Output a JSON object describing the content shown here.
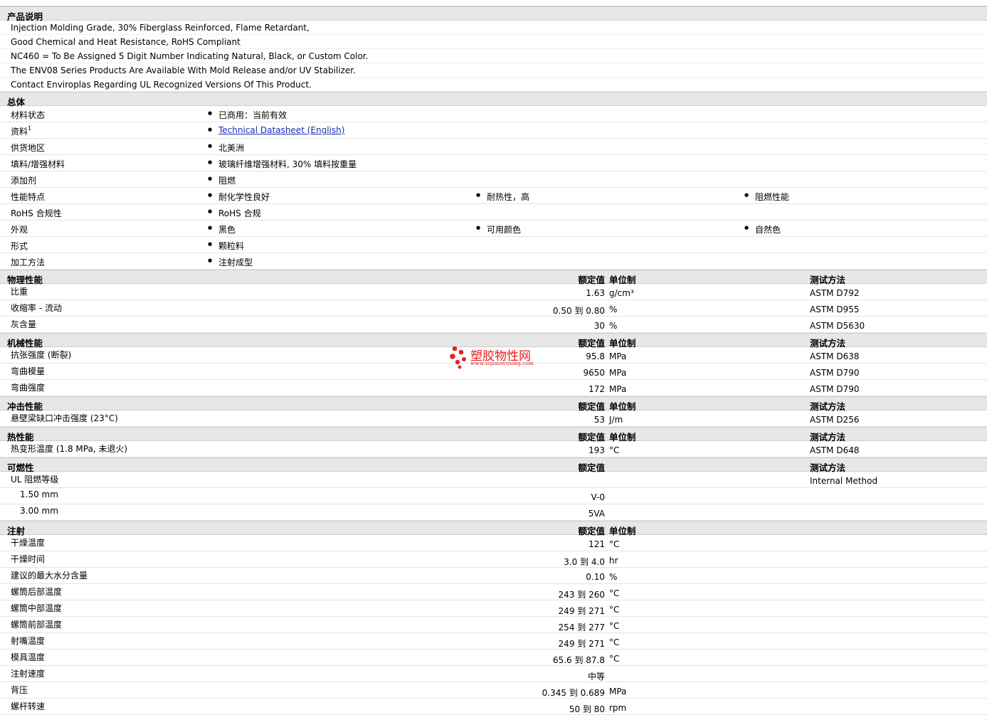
{
  "desc": {
    "title": "产品说明",
    "lines": [
      "Injection Molding Grade, 30% Fiberglass Reinforced, Flame Retardant,",
      "Good Chemical and Heat Resistance, RoHS Compliant",
      "NC460 = To Be Assigned 5 Digit Number Indicating Natural, Black, or Custom Color.",
      "The ENV08 Series Products Are Available With Mold Release and/or UV Stabilizer.",
      "Contact Enviroplas Regarding UL Recognized Versions Of This Product."
    ]
  },
  "general": {
    "title": "总体",
    "rows": [
      {
        "label": "材料状态",
        "items": [
          "已商用：当前有效"
        ]
      },
      {
        "label": "资料",
        "sup": "1",
        "items": [
          "Technical Datasheet (English)"
        ],
        "link": true
      },
      {
        "label": "供货地区",
        "items": [
          "北美洲"
        ]
      },
      {
        "label": "填料/增强材料",
        "items": [
          "玻璃纤维增强材料, 30% 填料按重量"
        ]
      },
      {
        "label": "添加剂",
        "items": [
          "阻燃"
        ]
      },
      {
        "label": "性能特点",
        "items": [
          "耐化学性良好",
          "耐热性，高",
          "阻燃性能"
        ]
      },
      {
        "label": "RoHS 合规性",
        "items": [
          "RoHS 合规"
        ]
      },
      {
        "label": "外观",
        "items": [
          "黑色",
          "可用颜色",
          "自然色"
        ]
      },
      {
        "label": "形式",
        "items": [
          "颗粒料"
        ]
      },
      {
        "label": "加工方法",
        "items": [
          "注射成型"
        ]
      }
    ]
  },
  "headers": {
    "value": "额定值",
    "unit": "单位制",
    "method": "测试方法"
  },
  "sections": [
    {
      "title": "物理性能",
      "showUnit": true,
      "showMethod": true,
      "rows": [
        {
          "label": "比重",
          "value": "1.63",
          "unit": "g/cm³",
          "method": "ASTM D792"
        },
        {
          "label": "收缩率 - 流动",
          "value": "0.50 到  0.80",
          "unit": "%",
          "method": "ASTM D955"
        },
        {
          "label": "灰含量",
          "value": "30",
          "unit": "%",
          "method": "ASTM D5630"
        }
      ]
    },
    {
      "title": "机械性能",
      "showUnit": true,
      "showMethod": true,
      "rows": [
        {
          "label": "抗张强度 (断裂)",
          "value": "95.8",
          "unit": "MPa",
          "method": "ASTM D638"
        },
        {
          "label": "弯曲模量",
          "value": "9650",
          "unit": "MPa",
          "method": "ASTM D790"
        },
        {
          "label": "弯曲强度",
          "value": "172",
          "unit": "MPa",
          "method": "ASTM D790"
        }
      ]
    },
    {
      "title": "冲击性能",
      "showUnit": true,
      "showMethod": true,
      "rows": [
        {
          "label": "悬壁梁缺口冲击强度 (23°C)",
          "value": "53",
          "unit": "J/m",
          "method": "ASTM D256"
        }
      ]
    },
    {
      "title": "热性能",
      "showUnit": true,
      "showMethod": true,
      "rows": [
        {
          "label": "热变形温度 (1.8 MPa, 未退火)",
          "value": "193",
          "unit": "°C",
          "method": "ASTM D648"
        }
      ]
    },
    {
      "title": "可燃性",
      "showUnit": false,
      "showMethod": true,
      "rows": [
        {
          "label": "UL 阻燃等级",
          "value": "",
          "unit": "",
          "method": "Internal Method"
        },
        {
          "label": "1.50 mm",
          "value": "V-0",
          "unit": "",
          "method": "",
          "sub": true
        },
        {
          "label": "3.00 mm",
          "value": "5VA",
          "unit": "",
          "method": "",
          "sub": true
        }
      ]
    },
    {
      "title": "注射",
      "showUnit": true,
      "showMethod": false,
      "rows": [
        {
          "label": "干燥温度",
          "value": "121",
          "unit": "°C",
          "method": ""
        },
        {
          "label": "干燥时间",
          "value": "3.0 到  4.0",
          "unit": "hr",
          "method": ""
        },
        {
          "label": "建议的最大水分含量",
          "value": "0.10",
          "unit": "%",
          "method": ""
        },
        {
          "label": "螺筒后部温度",
          "value": "243 到  260",
          "unit": "°C",
          "method": ""
        },
        {
          "label": "螺筒中部温度",
          "value": "249 到  271",
          "unit": "°C",
          "method": ""
        },
        {
          "label": "螺筒前部温度",
          "value": "254 到  277",
          "unit": "°C",
          "method": ""
        },
        {
          "label": "射嘴温度",
          "value": "249 到  271",
          "unit": "°C",
          "method": ""
        },
        {
          "label": "模具温度",
          "value": "65.6 到  87.8",
          "unit": "°C",
          "method": ""
        },
        {
          "label": "注射速度",
          "value": "中等",
          "unit": "",
          "method": ""
        },
        {
          "label": "背压",
          "value": "0.345 到  0.689",
          "unit": "MPa",
          "method": ""
        },
        {
          "label": "螺杆转速",
          "value": "50 到  80",
          "unit": "rpm",
          "method": ""
        }
      ]
    }
  ],
  "watermark": {
    "name": "塑胶物性网",
    "url": "www.sujiaowuxing.com"
  }
}
